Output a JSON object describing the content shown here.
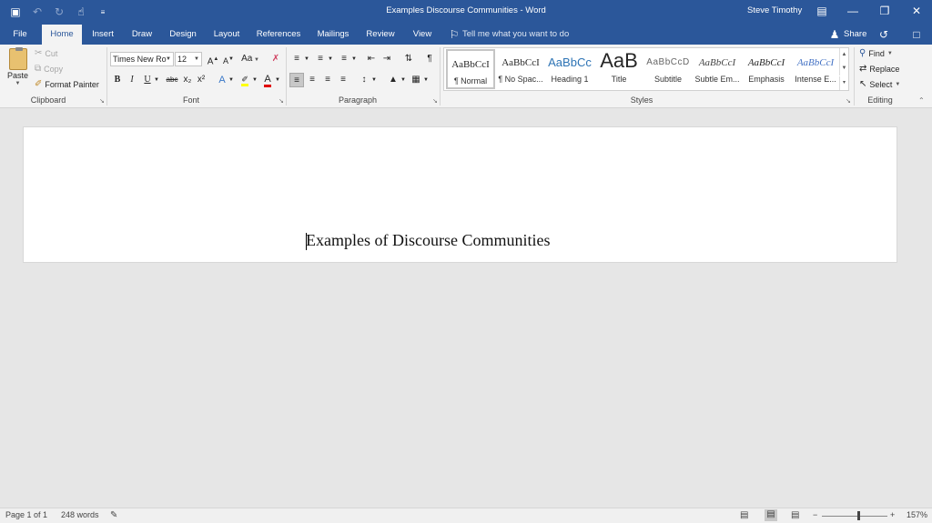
{
  "window": {
    "title": "Examples Discourse Communities  -  Word",
    "user": "Steve Timothy",
    "controls": [
      "minimize",
      "restore",
      "close"
    ]
  },
  "quick_access": [
    "save-icon",
    "undo-icon",
    "redo-icon",
    "touch-mode-icon",
    "customize-icon"
  ],
  "tabs": [
    {
      "label": "File"
    },
    {
      "label": "Home",
      "active": true
    },
    {
      "label": "Insert"
    },
    {
      "label": "Draw"
    },
    {
      "label": "Design"
    },
    {
      "label": "Layout"
    },
    {
      "label": "References"
    },
    {
      "label": "Mailings"
    },
    {
      "label": "Review"
    },
    {
      "label": "View"
    }
  ],
  "tell_me": "Tell me what you want to do",
  "share": "Share",
  "ribbon": {
    "clipboard": {
      "label": "Clipboard",
      "paste": "Paste",
      "cut": "Cut",
      "copy": "Copy",
      "format_painter": "Format Painter"
    },
    "font": {
      "label": "Font",
      "font_name": "Times New Ro",
      "font_size": "12",
      "change_case": "Aa",
      "bold": "B",
      "italic": "I",
      "underline": "U",
      "strikethrough": "abc",
      "subscript": "x₂",
      "superscript": "x²"
    },
    "paragraph": {
      "label": "Paragraph"
    },
    "styles": {
      "label": "Styles",
      "items": [
        {
          "sample": "AaBbCcI",
          "name": "¶ Normal",
          "selected": true
        },
        {
          "sample": "AaBbCcI",
          "name": "¶ No Spac..."
        },
        {
          "sample": "AaBbCc",
          "name": "Heading 1"
        },
        {
          "sample": "AaB",
          "name": "Title"
        },
        {
          "sample": "AaBbCcD",
          "name": "Subtitle"
        },
        {
          "sample": "AaBbCcI",
          "name": "Subtle Em..."
        },
        {
          "sample": "AaBbCcI",
          "name": "Emphasis"
        },
        {
          "sample": "AaBbCcI",
          "name": "Intense E..."
        }
      ]
    },
    "editing": {
      "label": "Editing",
      "find": "Find",
      "replace": "Replace",
      "select": "Select"
    }
  },
  "document": {
    "text": "Examples of Discourse Communities"
  },
  "status": {
    "page": "Page 1 of 1",
    "words": "248 words",
    "zoom": "157%"
  },
  "colors": {
    "word_blue": "#2b579a",
    "highlight": "#ffff00",
    "font_color": "#e00000"
  }
}
